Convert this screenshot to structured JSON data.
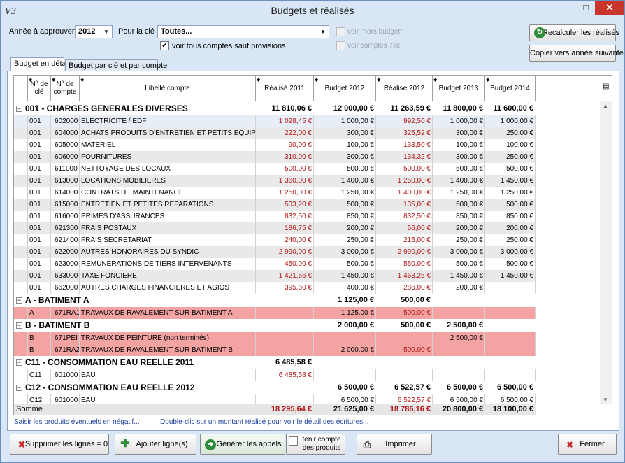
{
  "window": {
    "app_icon": "V3",
    "title": "Budgets et réalisés",
    "min_glyph": "–",
    "max_glyph": "□",
    "close_glyph": "✕"
  },
  "filters": {
    "year_label": "Année à approuver",
    "year_value": "2012",
    "key_label": "Pour la clé",
    "key_value": "Toutes...",
    "show_all_label": "voir tous comptes sauf provisions",
    "show_all_checked": true,
    "hors_budget_label": "voir \"hors budget\"",
    "comptes7_label": "voir comptes 7xx"
  },
  "buttons": {
    "recalc": "Recalculer les réalisés",
    "copy_next": "Copier vers année suivante",
    "delete_zero": "Supprimer les lignes = 0",
    "add_line": "Ajouter ligne(s)",
    "generate": "Générer les appels",
    "tenir_line1": "tenir compte",
    "tenir_line2": "des produits",
    "print": "Imprimer",
    "close": "Fermer"
  },
  "tabs": [
    {
      "label": "Budget en détail"
    },
    {
      "label": "Budget par clé et par compte"
    }
  ],
  "columns": {
    "cle": "N° de clé",
    "compte": "N° de compte",
    "libelle": "Libellé compte",
    "r2011": "Réalisé 2011",
    "b2012": "Budget 2012",
    "r2012": "Réalisé 2012",
    "b2013": "Budget 2013",
    "b2014": "Budget 2014"
  },
  "groups": [
    {
      "title": "001 - CHARGES GENERALES DIVERSES",
      "totals": [
        "11 810,06 €",
        "12 000,00 €",
        "11 263,59 €",
        "11 800,00 €",
        "11 600,00 €"
      ],
      "rows": [
        {
          "cle": "001",
          "compte": "602000",
          "libelle": "ELECTRICITE / EDF",
          "r2011": "1 028,45 €",
          "b2012": "1 000,00 €",
          "r2012": "992,50 €",
          "b2013": "1 000,00 €",
          "b2014": "1 000,00 €"
        },
        {
          "cle": "001",
          "compte": "604000",
          "libelle": "ACHATS PRODUITS D'ENTRETIEN ET PETITS EQUIPE",
          "r2011": "222,00 €",
          "b2012": "300,00 €",
          "r2012": "325,52 €",
          "b2013": "300,00 €",
          "b2014": "250,00 €"
        },
        {
          "cle": "001",
          "compte": "605000",
          "libelle": "MATERIEL",
          "r2011": "90,00 €",
          "b2012": "100,00 €",
          "r2012": "133,50 €",
          "b2013": "100,00 €",
          "b2014": "100,00 €"
        },
        {
          "cle": "001",
          "compte": "606000",
          "libelle": "FOURNITURES",
          "r2011": "310,00 €",
          "b2012": "300,00 €",
          "r2012": "134,32 €",
          "b2013": "300,00 €",
          "b2014": "250,00 €"
        },
        {
          "cle": "001",
          "compte": "611000",
          "libelle": "NETTOYAGE DES LOCAUX",
          "r2011": "500,00 €",
          "b2012": "500,00 €",
          "r2012": "500,00 €",
          "b2013": "500,00 €",
          "b2014": "500,00 €"
        },
        {
          "cle": "001",
          "compte": "613000",
          "libelle": "LOCATIONS MOBILIERES",
          "r2011": "1 360,00 €",
          "b2012": "1 400,00 €",
          "r2012": "1 250,00 €",
          "b2013": "1 400,00 €",
          "b2014": "1 450,00 €"
        },
        {
          "cle": "001",
          "compte": "614000",
          "libelle": "CONTRATS DE MAINTENANCE",
          "r2011": "1 250,00 €",
          "b2012": "1 250,00 €",
          "r2012": "1 400,00 €",
          "b2013": "1 250,00 €",
          "b2014": "1 250,00 €"
        },
        {
          "cle": "001",
          "compte": "615000",
          "libelle": "ENTRETIEN ET PETITES REPARATIONS",
          "r2011": "533,20 €",
          "b2012": "500,00 €",
          "r2012": "135,00 €",
          "b2013": "500,00 €",
          "b2014": "500,00 €"
        },
        {
          "cle": "001",
          "compte": "616000",
          "libelle": "PRIMES D'ASSURANCES",
          "r2011": "832,50 €",
          "b2012": "850,00 €",
          "r2012": "832,50 €",
          "b2013": "850,00 €",
          "b2014": "850,00 €"
        },
        {
          "cle": "001",
          "compte": "621300",
          "libelle": "FRAIS POSTAUX",
          "r2011": "186,75 €",
          "b2012": "200,00 €",
          "r2012": "56,00 €",
          "b2013": "200,00 €",
          "b2014": "200,00 €"
        },
        {
          "cle": "001",
          "compte": "621400",
          "libelle": "FRAIS SECRETARIAT",
          "r2011": "240,00 €",
          "b2012": "250,00 €",
          "r2012": "215,00 €",
          "b2013": "250,00 €",
          "b2014": "250,00 €"
        },
        {
          "cle": "001",
          "compte": "622000",
          "libelle": "AUTRES HONORAIRES DU SYNDIC",
          "r2011": "2 990,00 €",
          "b2012": "3 000,00 €",
          "r2012": "2 990,00 €",
          "b2013": "3 000,00 €",
          "b2014": "3 000,00 €"
        },
        {
          "cle": "001",
          "compte": "623000",
          "libelle": "REMUNERATIONS DE TIERS INTERVENANTS",
          "r2011": "450,00 €",
          "b2012": "500,00 €",
          "r2012": "550,00 €",
          "b2013": "500,00 €",
          "b2014": "500,00 €"
        },
        {
          "cle": "001",
          "compte": "633000",
          "libelle": "TAXE FONCIERE",
          "r2011": "1 421,56 €",
          "b2012": "1 450,00 €",
          "r2012": "1 463,25 €",
          "b2013": "1 450,00 €",
          "b2014": "1 450,00 €"
        },
        {
          "cle": "001",
          "compte": "662000",
          "libelle": "AUTRES CHARGES FINANCIERES ET AGIOS",
          "r2011": "395,60 €",
          "b2012": "400,00 €",
          "r2012": "286,00 €",
          "b2013": "200,00 €",
          "b2014": ""
        }
      ]
    },
    {
      "title": "A - BATIMENT A",
      "totals": [
        "",
        "1 125,00 €",
        "500,00 €",
        "",
        ""
      ],
      "rows": [
        {
          "cle": "A",
          "compte": "671RA1",
          "libelle": "TRAVAUX DE RAVALEMENT SUR BATIMENT A",
          "r2011": "",
          "b2012": "1 125,00 €",
          "r2012": "500,00 €",
          "b2013": "",
          "b2014": "",
          "highlight": true
        }
      ]
    },
    {
      "title": "B - BATIMENT B",
      "totals": [
        "",
        "2 000,00 €",
        "500,00 €",
        "2 500,00 €",
        ""
      ],
      "rows": [
        {
          "cle": "B",
          "compte": "671PEI",
          "libelle": "TRAVAUX DE  PEINTURE (non terminés)",
          "r2011": "",
          "b2012": "",
          "r2012": "",
          "b2013": "2 500,00 €",
          "b2014": "",
          "highlight": true
        },
        {
          "cle": "B",
          "compte": "671RA2",
          "libelle": "TRAVAUX DE RAVALEMENT SUR BATIMENT B",
          "r2011": "",
          "b2012": "2 000,00 €",
          "r2012": "500,00 €",
          "b2013": "",
          "b2014": "",
          "highlight": true
        }
      ]
    },
    {
      "title": "C11 - CONSOMMATION EAU REELLE 2011",
      "totals": [
        "6 485,58 €",
        "",
        "",
        "",
        ""
      ],
      "rows": [
        {
          "cle": "C11",
          "compte": "601000",
          "libelle": "EAU",
          "r2011": "6 485,58 €",
          "b2012": "",
          "r2012": "",
          "b2013": "",
          "b2014": ""
        }
      ]
    },
    {
      "title": "C12 - CONSOMMATION EAU REELLE 2012",
      "totals": [
        "",
        "6 500,00 €",
        "6 522,57 €",
        "6 500,00 €",
        "6 500,00 €"
      ],
      "rows": [
        {
          "cle": "C12",
          "compte": "601000",
          "libelle": "EAU",
          "r2011": "",
          "b2012": "6 500,00 €",
          "r2012": "6 522,57 €",
          "b2013": "6 500,00 €",
          "b2014": "6 500,00 €"
        }
      ]
    }
  ],
  "sum_row": {
    "label": "Somme",
    "r2011": "18 295,64 €",
    "b2012": "21 625,00 €",
    "r2012": "18 786,16 €",
    "b2013": "20 800,00 €",
    "b2014": "18 100,00 €"
  },
  "info": {
    "left": "Saisir les produits éventuels en négatif...",
    "right": "Double-clic sur un montant réalisé pour voir le détail des écritures..."
  }
}
